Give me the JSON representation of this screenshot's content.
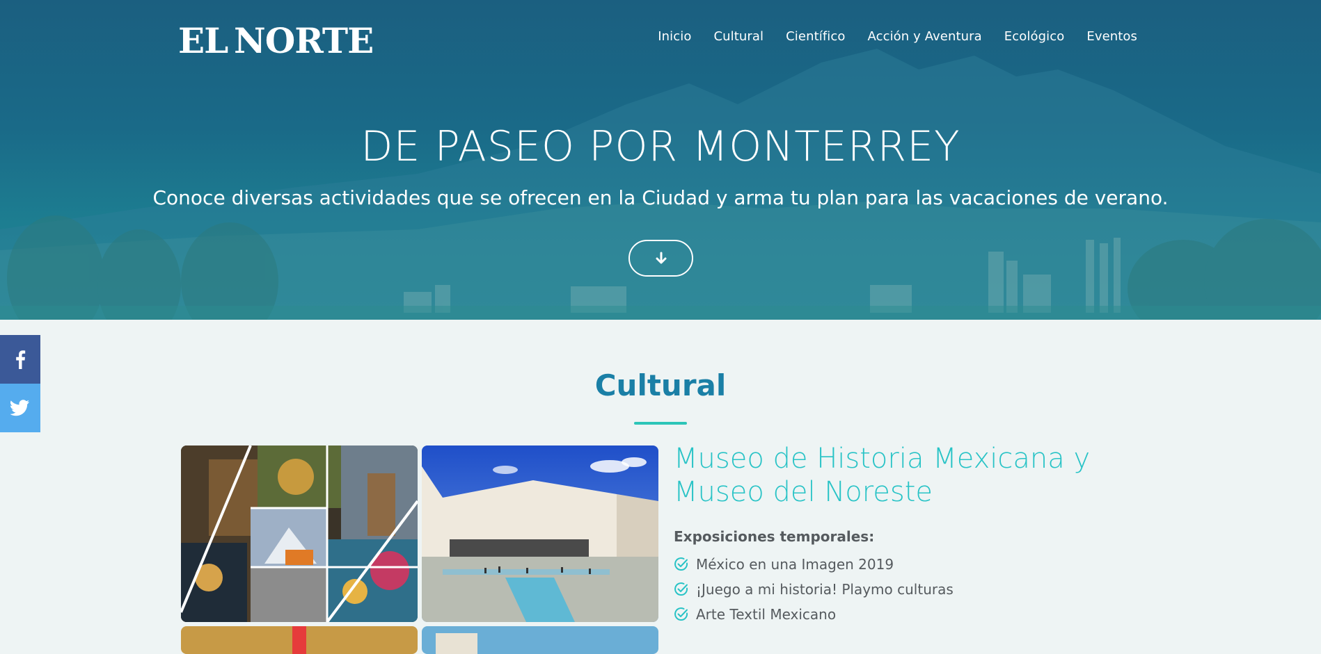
{
  "brand": {
    "logo_text": "EL NORTE"
  },
  "nav": {
    "items": [
      {
        "label": "Inicio"
      },
      {
        "label": "Cultural"
      },
      {
        "label": "Científico"
      },
      {
        "label": "Acción y Aventura"
      },
      {
        "label": "Ecológico"
      },
      {
        "label": "Eventos"
      }
    ]
  },
  "hero": {
    "title": "DE PASEO POR MONTERREY",
    "subtitle": "Conoce diversas actividades que se ofrecen en la Ciudad y arma tu plan para las vacaciones de verano.",
    "scroll_icon": "arrow-down-icon"
  },
  "social": {
    "facebook_icon": "facebook-icon",
    "twitter_icon": "twitter-icon",
    "facebook_color": "#3b5998",
    "twitter_color": "#55acee"
  },
  "section": {
    "title": "Cultural",
    "venue_title": "Museo de Historia Mexicana y Museo del Noreste",
    "expo_label": "Exposiciones temporales:",
    "exhibitions": [
      {
        "label": "México en una Imagen 2019"
      },
      {
        "label": "¡Juego a mi historia! Playmo culturas"
      },
      {
        "label": "Arte Textil Mexicano"
      }
    ]
  },
  "colors": {
    "accent_teal": "#28c3c6",
    "section_title": "#1a7fa6",
    "rule": "#2cc5b8",
    "text": "#555a5e"
  }
}
